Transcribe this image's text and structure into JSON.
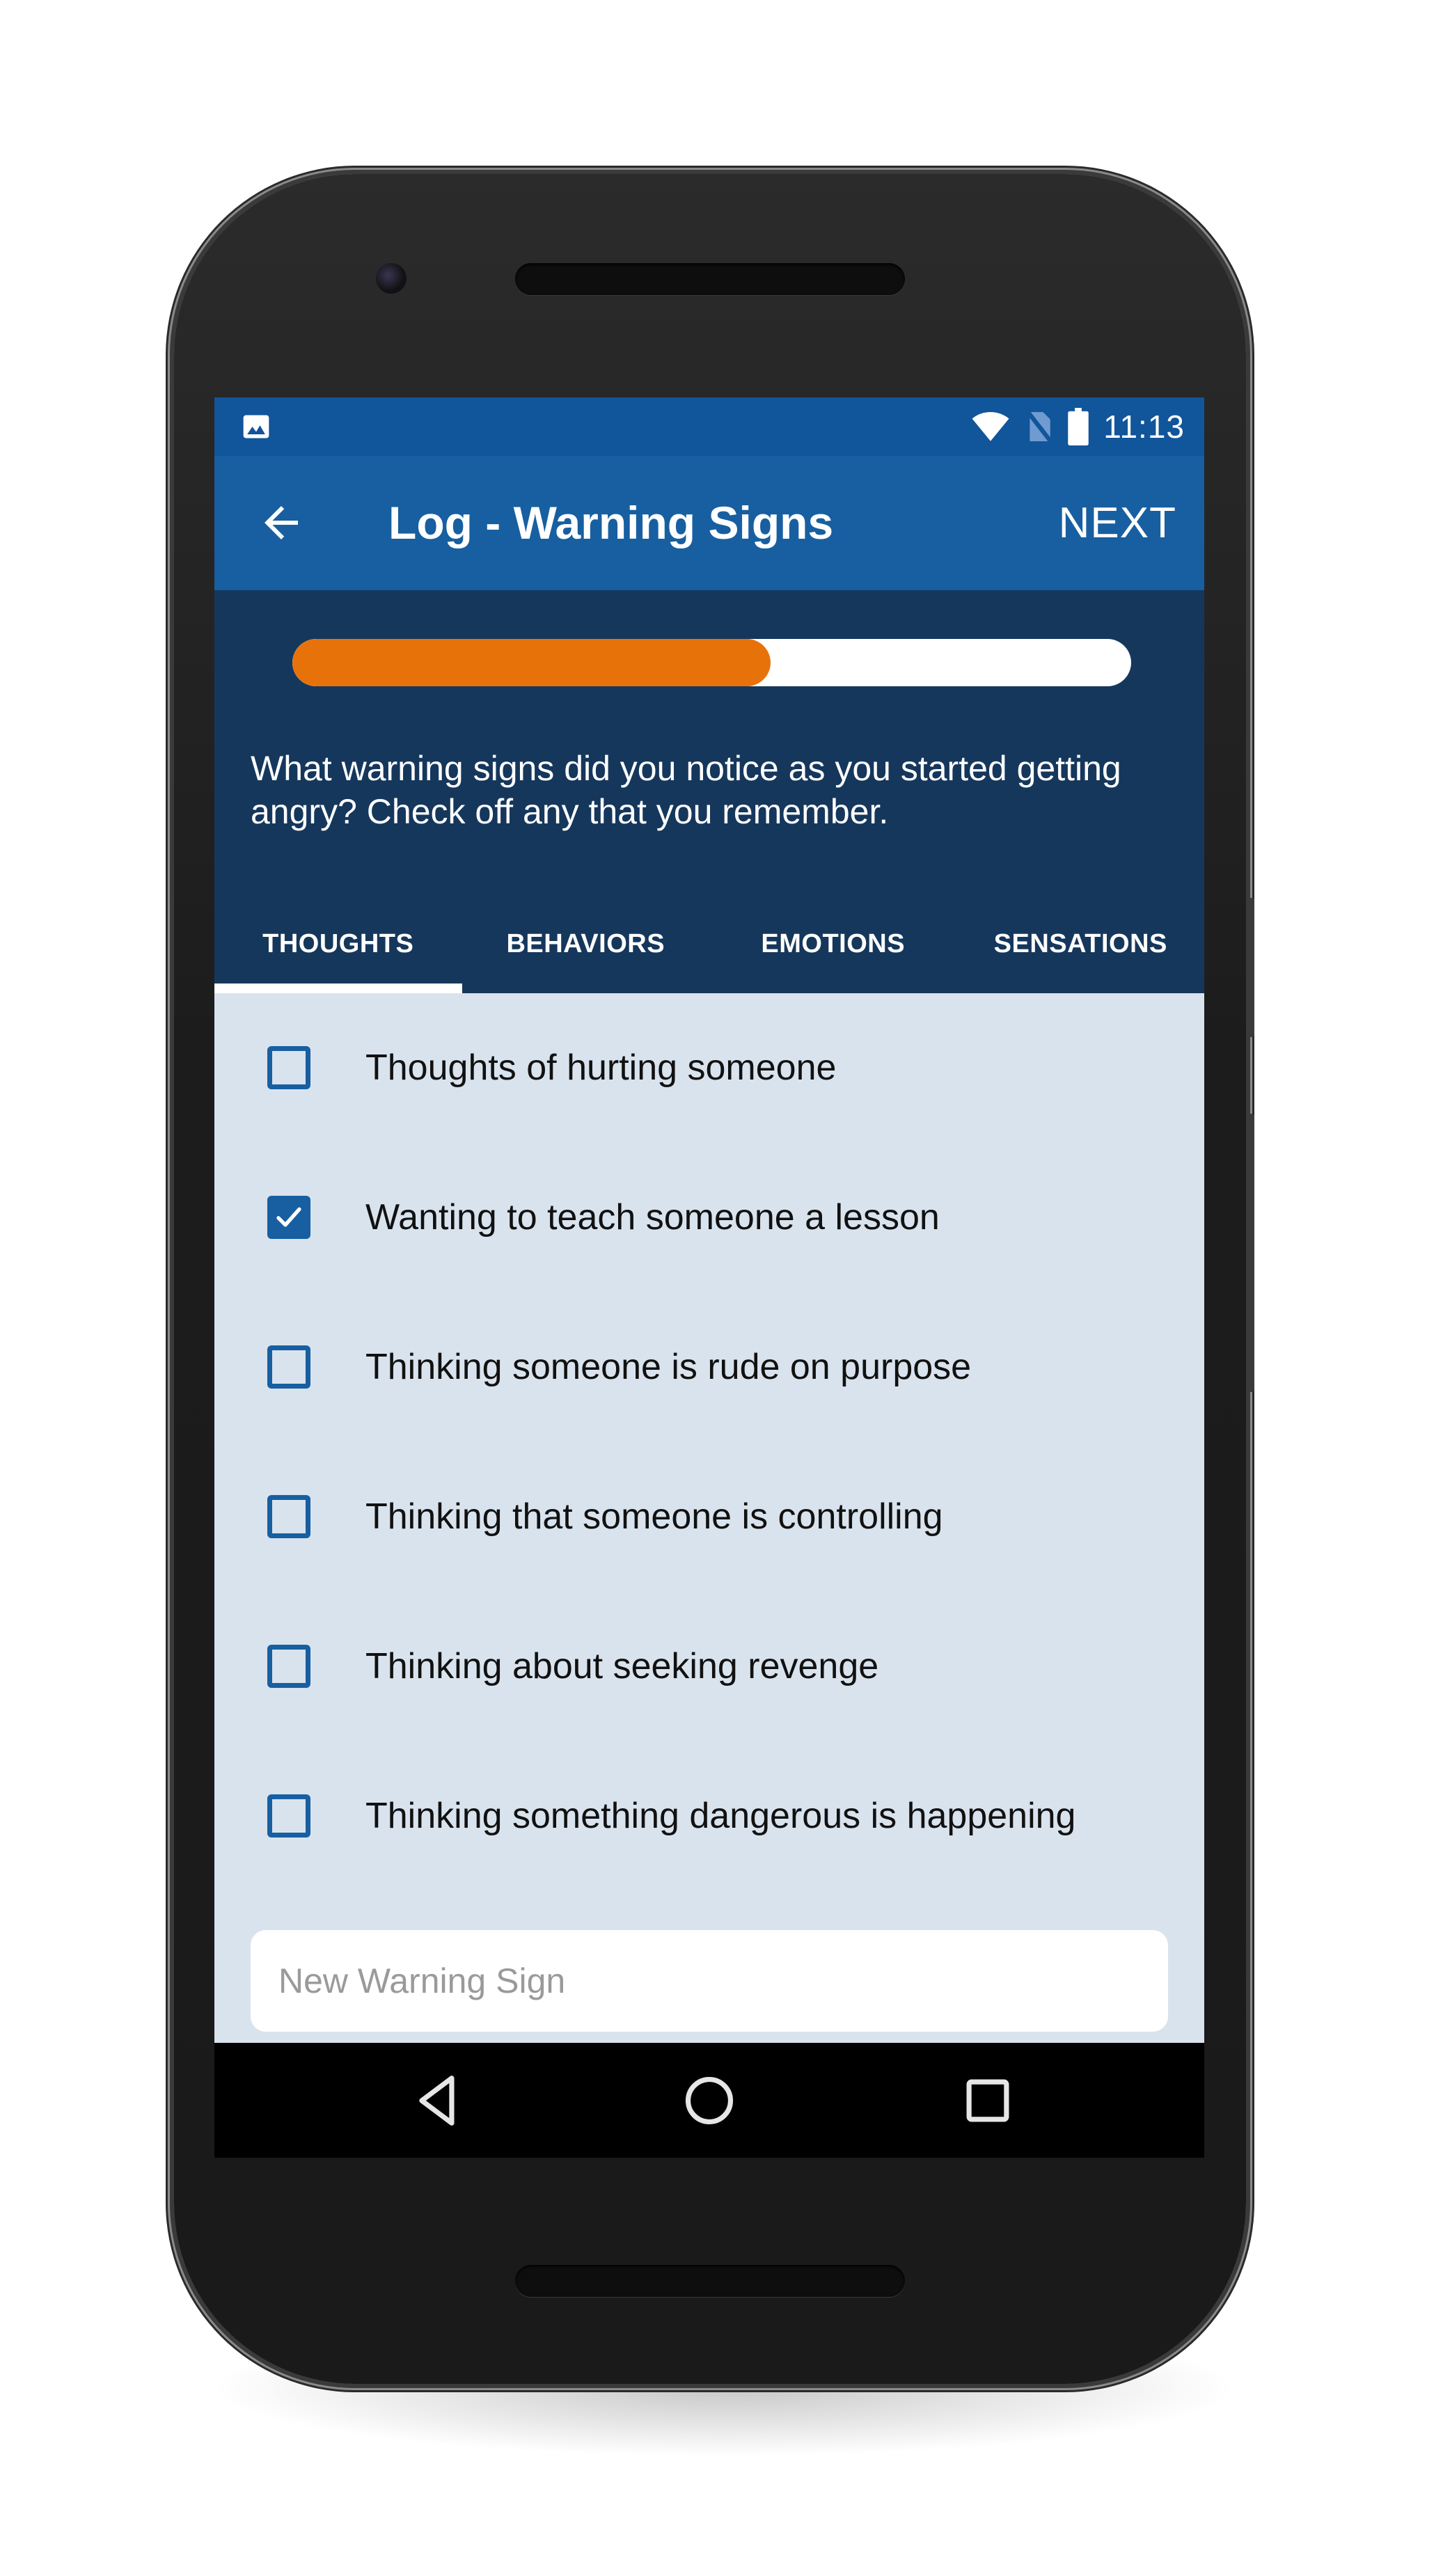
{
  "status_bar": {
    "time": "11:13",
    "icons": [
      "image-notification-icon",
      "wifi-icon",
      "no-sim-icon",
      "battery-icon"
    ]
  },
  "app_bar": {
    "back_icon": "arrow-left-icon",
    "title": "Log - Warning Signs",
    "next_label": "NEXT"
  },
  "progress": {
    "value_percent": 57,
    "fill_color": "#e8720a",
    "track_color": "#ffffff"
  },
  "prompt": "What warning signs did you notice as you started getting angry? Check off any that you remember.",
  "tabs": [
    {
      "label": "THOUGHTS",
      "selected": true
    },
    {
      "label": "BEHAVIORS",
      "selected": false
    },
    {
      "label": "EMOTIONS",
      "selected": false
    },
    {
      "label": "SENSATIONS",
      "selected": false
    }
  ],
  "warning_signs": [
    {
      "label": "Thoughts of hurting someone",
      "checked": false
    },
    {
      "label": "Wanting to teach someone a lesson",
      "checked": true
    },
    {
      "label": "Thinking someone is rude on purpose",
      "checked": false
    },
    {
      "label": "Thinking that someone is controlling",
      "checked": false
    },
    {
      "label": "Thinking about seeking revenge",
      "checked": false
    },
    {
      "label": "Thinking something dangerous is happening",
      "checked": false
    }
  ],
  "new_sign_input": {
    "value": "",
    "placeholder": "New Warning Sign"
  },
  "nav_bar": {
    "buttons": [
      "back-triangle-icon",
      "home-circle-icon",
      "recents-square-icon"
    ]
  },
  "colors": {
    "status_bar": "#11559b",
    "app_bar": "#175fa1",
    "header": "#16375c",
    "list_background": "#d9e3ee",
    "checkbox": "#175fa1",
    "accent_orange": "#e8720a"
  }
}
